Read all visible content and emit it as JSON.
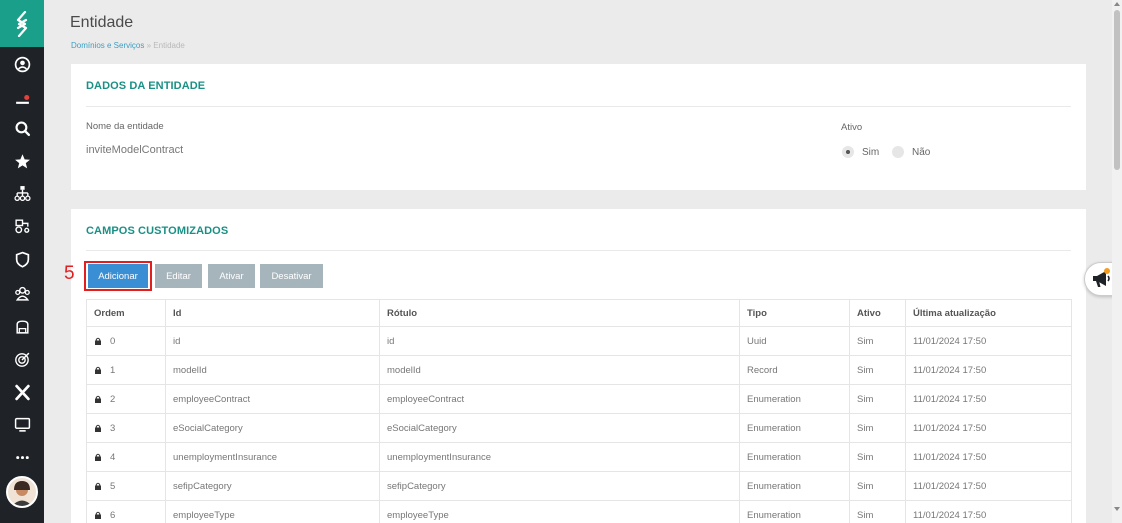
{
  "header": {
    "title": "Entidade",
    "breadcrumb": {
      "parent": "Domínios e Serviços",
      "separator": "»",
      "current": "Entidade"
    }
  },
  "entity_card": {
    "title": "DADOS DA ENTIDADE",
    "name_label": "Nome da entidade",
    "name_value": "inviteModelContract",
    "active_label": "Ativo",
    "active_options": [
      "Sim",
      "Não"
    ],
    "active_selected": "Sim"
  },
  "fields_card": {
    "title": "CAMPOS CUSTOMIZADOS",
    "step_number": "5",
    "buttons": {
      "add": "Adicionar",
      "edit": "Editar",
      "activate": "Ativar",
      "deactivate": "Desativar"
    },
    "columns": [
      "Ordem",
      "Id",
      "Rótulo",
      "Tipo",
      "Ativo",
      "Última atualização"
    ],
    "rows": [
      {
        "order": "0",
        "id": "id",
        "label": "id",
        "type": "Uuid",
        "active": "Sim",
        "updated": "11/01/2024 17:50"
      },
      {
        "order": "1",
        "id": "modelId",
        "label": "modelId",
        "type": "Record",
        "active": "Sim",
        "updated": "11/01/2024 17:50"
      },
      {
        "order": "2",
        "id": "employeeContract",
        "label": "employeeContract",
        "type": "Enumeration",
        "active": "Sim",
        "updated": "11/01/2024 17:50"
      },
      {
        "order": "3",
        "id": "eSocialCategory",
        "label": "eSocialCategory",
        "type": "Enumeration",
        "active": "Sim",
        "updated": "11/01/2024 17:50"
      },
      {
        "order": "4",
        "id": "unemploymentInsurance",
        "label": "unemploymentInsurance",
        "type": "Enumeration",
        "active": "Sim",
        "updated": "11/01/2024 17:50"
      },
      {
        "order": "5",
        "id": "sefipCategory",
        "label": "sefipCategory",
        "type": "Enumeration",
        "active": "Sim",
        "updated": "11/01/2024 17:50"
      },
      {
        "order": "6",
        "id": "employeeType",
        "label": "employeeType",
        "type": "Enumeration",
        "active": "Sim",
        "updated": "11/01/2024 17:50"
      }
    ]
  },
  "sidebar": {
    "items": [
      "profile-icon",
      "notifications-icon",
      "search-icon",
      "star-icon",
      "org-chart-icon",
      "tractor-icon",
      "shield-icon",
      "people-icon",
      "backpack-icon",
      "target-icon",
      "x-icon",
      "monitor-icon",
      "more-icon"
    ]
  },
  "colors": {
    "accent": "#1aa08a",
    "primary": "#3a8ed4",
    "highlight": "#e21e1e",
    "sidebar": "#1f2328"
  }
}
